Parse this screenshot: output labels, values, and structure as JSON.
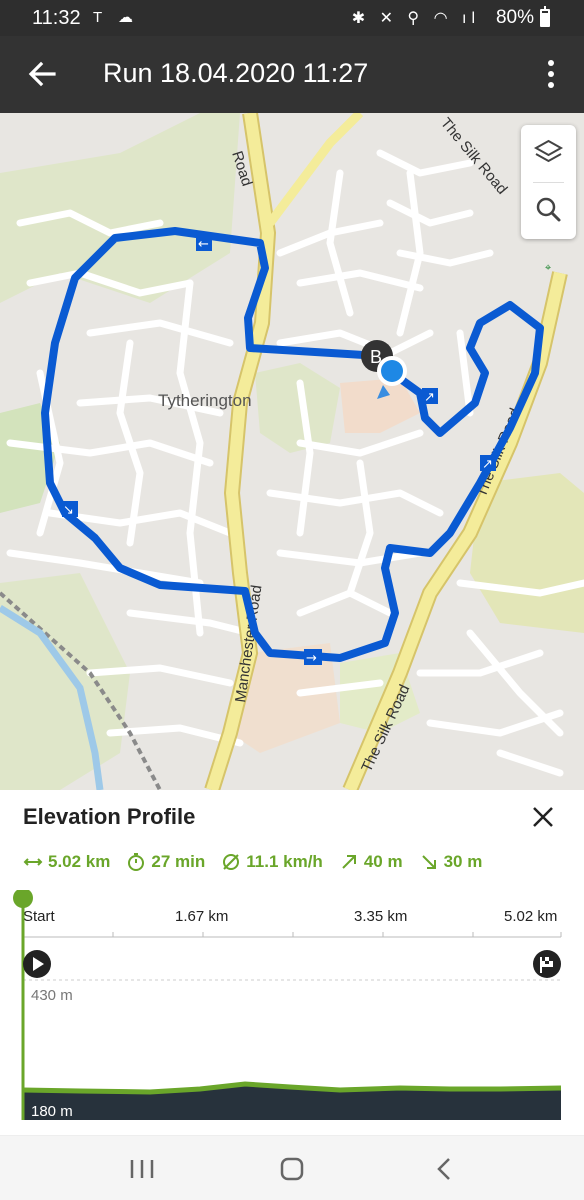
{
  "status_bar": {
    "time": "11:32",
    "battery": "80%"
  },
  "app_bar": {
    "title": "Run 18.04.2020 11:27"
  },
  "map": {
    "place_label": "Tytherington",
    "road_labels": [
      "Road",
      "The Silk Road",
      "The Silk Road",
      "The Silk Road",
      "Manchester Road"
    ],
    "route_color": "#0a5ad2",
    "start_marker": "B"
  },
  "elevation": {
    "title": "Elevation Profile",
    "stats": {
      "distance": "5.02 km",
      "duration": "27 min",
      "avg_speed": "11.1 km/h",
      "ascent": "40 m",
      "descent": "30 m"
    },
    "distance_ticks": [
      "Start",
      "1.67 km",
      "3.35 km",
      "5.02 km"
    ],
    "elevation_max_label": "430 m",
    "elevation_min_label": "180 m",
    "accent": "#6aa62a"
  }
}
